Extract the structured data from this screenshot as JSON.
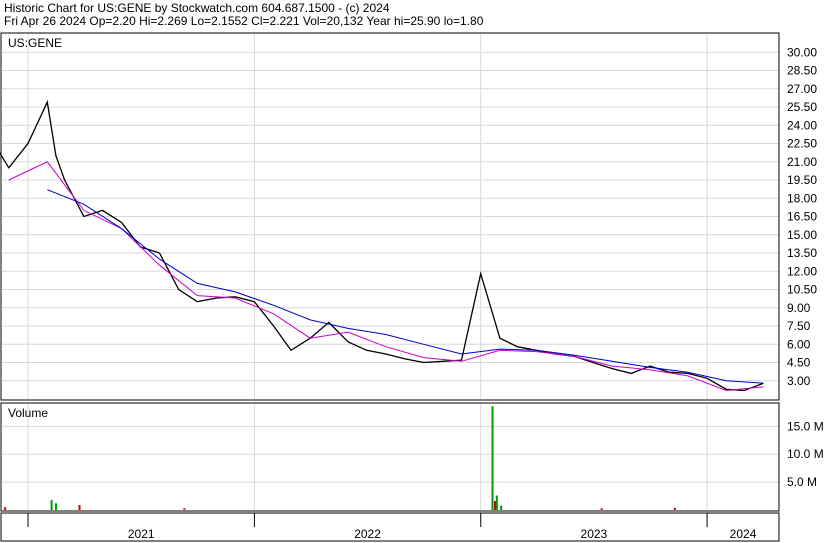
{
  "header": {
    "line1": "Historic Chart for US:GENE by Stockwatch.com 604.687.1500 - (c) 2024",
    "line2": "Fri Apr 26 2024   Op=2.20   Hi=2.269   Lo=2.1552   Cl=2.221   Vol=20,132   Year hi=25.90   lo=1.80"
  },
  "chart_data": [
    {
      "type": "line",
      "title": "US:GENE",
      "ylim": [
        1.5,
        31.5
      ],
      "y_ticks": [
        "30.00",
        "28.50",
        "27.00",
        "25.50",
        "24.00",
        "22.50",
        "21.00",
        "19.50",
        "18.00",
        "16.50",
        "15.00",
        "13.50",
        "12.00",
        "10.50",
        "9.00",
        "7.50",
        "6.00",
        "4.50",
        "3.00"
      ],
      "x_ticks": [
        "2021",
        "2022",
        "2023",
        "2024"
      ],
      "x_range": [
        "2020-11-20",
        "2024-04-26"
      ],
      "grid": true,
      "colors": {
        "price": "#000000",
        "ma_short": "#cc00cc",
        "ma_long": "#0000cc"
      },
      "series": [
        {
          "key": "price",
          "x": [
            "2020-11",
            "2020-12",
            "2021-01",
            "2021-02",
            "2021-02-15",
            "2021-03",
            "2021-04",
            "2021-05",
            "2021-06",
            "2021-07",
            "2021-08",
            "2021-09",
            "2021-10",
            "2021-11",
            "2021-12",
            "2022-01",
            "2022-02",
            "2022-03",
            "2022-04",
            "2022-05",
            "2022-06",
            "2022-07",
            "2022-08",
            "2022-09",
            "2022-10",
            "2022-11",
            "2022-12",
            "2023-01",
            "2023-02",
            "2023-03",
            "2023-04",
            "2023-05",
            "2023-06",
            "2023-07",
            "2023-08",
            "2023-09",
            "2023-10",
            "2023-11",
            "2023-12",
            "2024-01",
            "2024-02",
            "2024-03",
            "2024-04"
          ],
          "y": [
            23.0,
            20.5,
            22.5,
            25.9,
            21.5,
            19.5,
            16.5,
            17.0,
            16.0,
            14.0,
            13.5,
            10.5,
            9.5,
            9.8,
            9.9,
            9.5,
            7.5,
            5.5,
            6.5,
            7.8,
            6.2,
            5.5,
            5.2,
            4.8,
            4.5,
            4.6,
            4.7,
            11.8,
            6.5,
            5.8,
            5.5,
            5.2,
            5.0,
            4.5,
            4.0,
            3.6,
            4.2,
            3.7,
            3.6,
            3.2,
            2.3,
            2.2,
            2.8
          ]
        },
        {
          "key": "ma_short",
          "x": [
            "2020-12",
            "2021-02",
            "2021-04",
            "2021-06",
            "2021-08",
            "2021-10",
            "2021-12",
            "2022-02",
            "2022-04",
            "2022-06",
            "2022-08",
            "2022-10",
            "2022-12",
            "2023-02",
            "2023-04",
            "2023-06",
            "2023-08",
            "2023-10",
            "2023-12",
            "2024-02",
            "2024-04"
          ],
          "y": [
            19.5,
            21.0,
            17.0,
            15.5,
            12.5,
            10.0,
            9.8,
            8.5,
            6.5,
            7.0,
            5.8,
            4.9,
            4.6,
            5.5,
            5.4,
            5.0,
            4.2,
            3.9,
            3.4,
            2.2,
            2.5
          ]
        },
        {
          "key": "ma_long",
          "x": [
            "2021-02",
            "2021-04",
            "2021-06",
            "2021-08",
            "2021-10",
            "2021-12",
            "2022-02",
            "2022-04",
            "2022-06",
            "2022-08",
            "2022-10",
            "2022-12",
            "2023-02",
            "2023-04",
            "2023-06",
            "2023-08",
            "2023-10",
            "2023-12",
            "2024-02",
            "2024-04"
          ],
          "y": [
            18.7,
            17.5,
            15.5,
            13.0,
            11.0,
            10.3,
            9.2,
            8.0,
            7.3,
            6.8,
            6.0,
            5.2,
            5.6,
            5.5,
            5.1,
            4.6,
            4.1,
            3.7,
            3.0,
            2.8
          ]
        }
      ]
    },
    {
      "type": "bar",
      "title": "Volume",
      "ylim": [
        0,
        19
      ],
      "y_ticks": [
        "15.0 M",
        "10.0 M",
        "5.0 M"
      ],
      "bars": [
        {
          "x": "2020-11-25",
          "y": 0.5,
          "color": "#cc0000"
        },
        {
          "x": "2021-02-08",
          "y": 1.8,
          "color": "#009900"
        },
        {
          "x": "2021-02-15",
          "y": 1.2,
          "color": "#009900"
        },
        {
          "x": "2021-03-25",
          "y": 0.9,
          "color": "#cc0000"
        },
        {
          "x": "2021-09-10",
          "y": 0.3,
          "color": "#cc0000"
        },
        {
          "x": "2023-01-20",
          "y": 18.6,
          "color": "#009900"
        },
        {
          "x": "2023-01-24",
          "y": 1.6,
          "color": "#cc0000"
        },
        {
          "x": "2023-01-27",
          "y": 2.6,
          "color": "#009900"
        },
        {
          "x": "2023-02-03",
          "y": 0.8,
          "color": "#009900"
        },
        {
          "x": "2023-07-15",
          "y": 0.3,
          "color": "#cc0000"
        },
        {
          "x": "2023-11-10",
          "y": 0.4,
          "color": "#cc0000"
        }
      ]
    }
  ]
}
